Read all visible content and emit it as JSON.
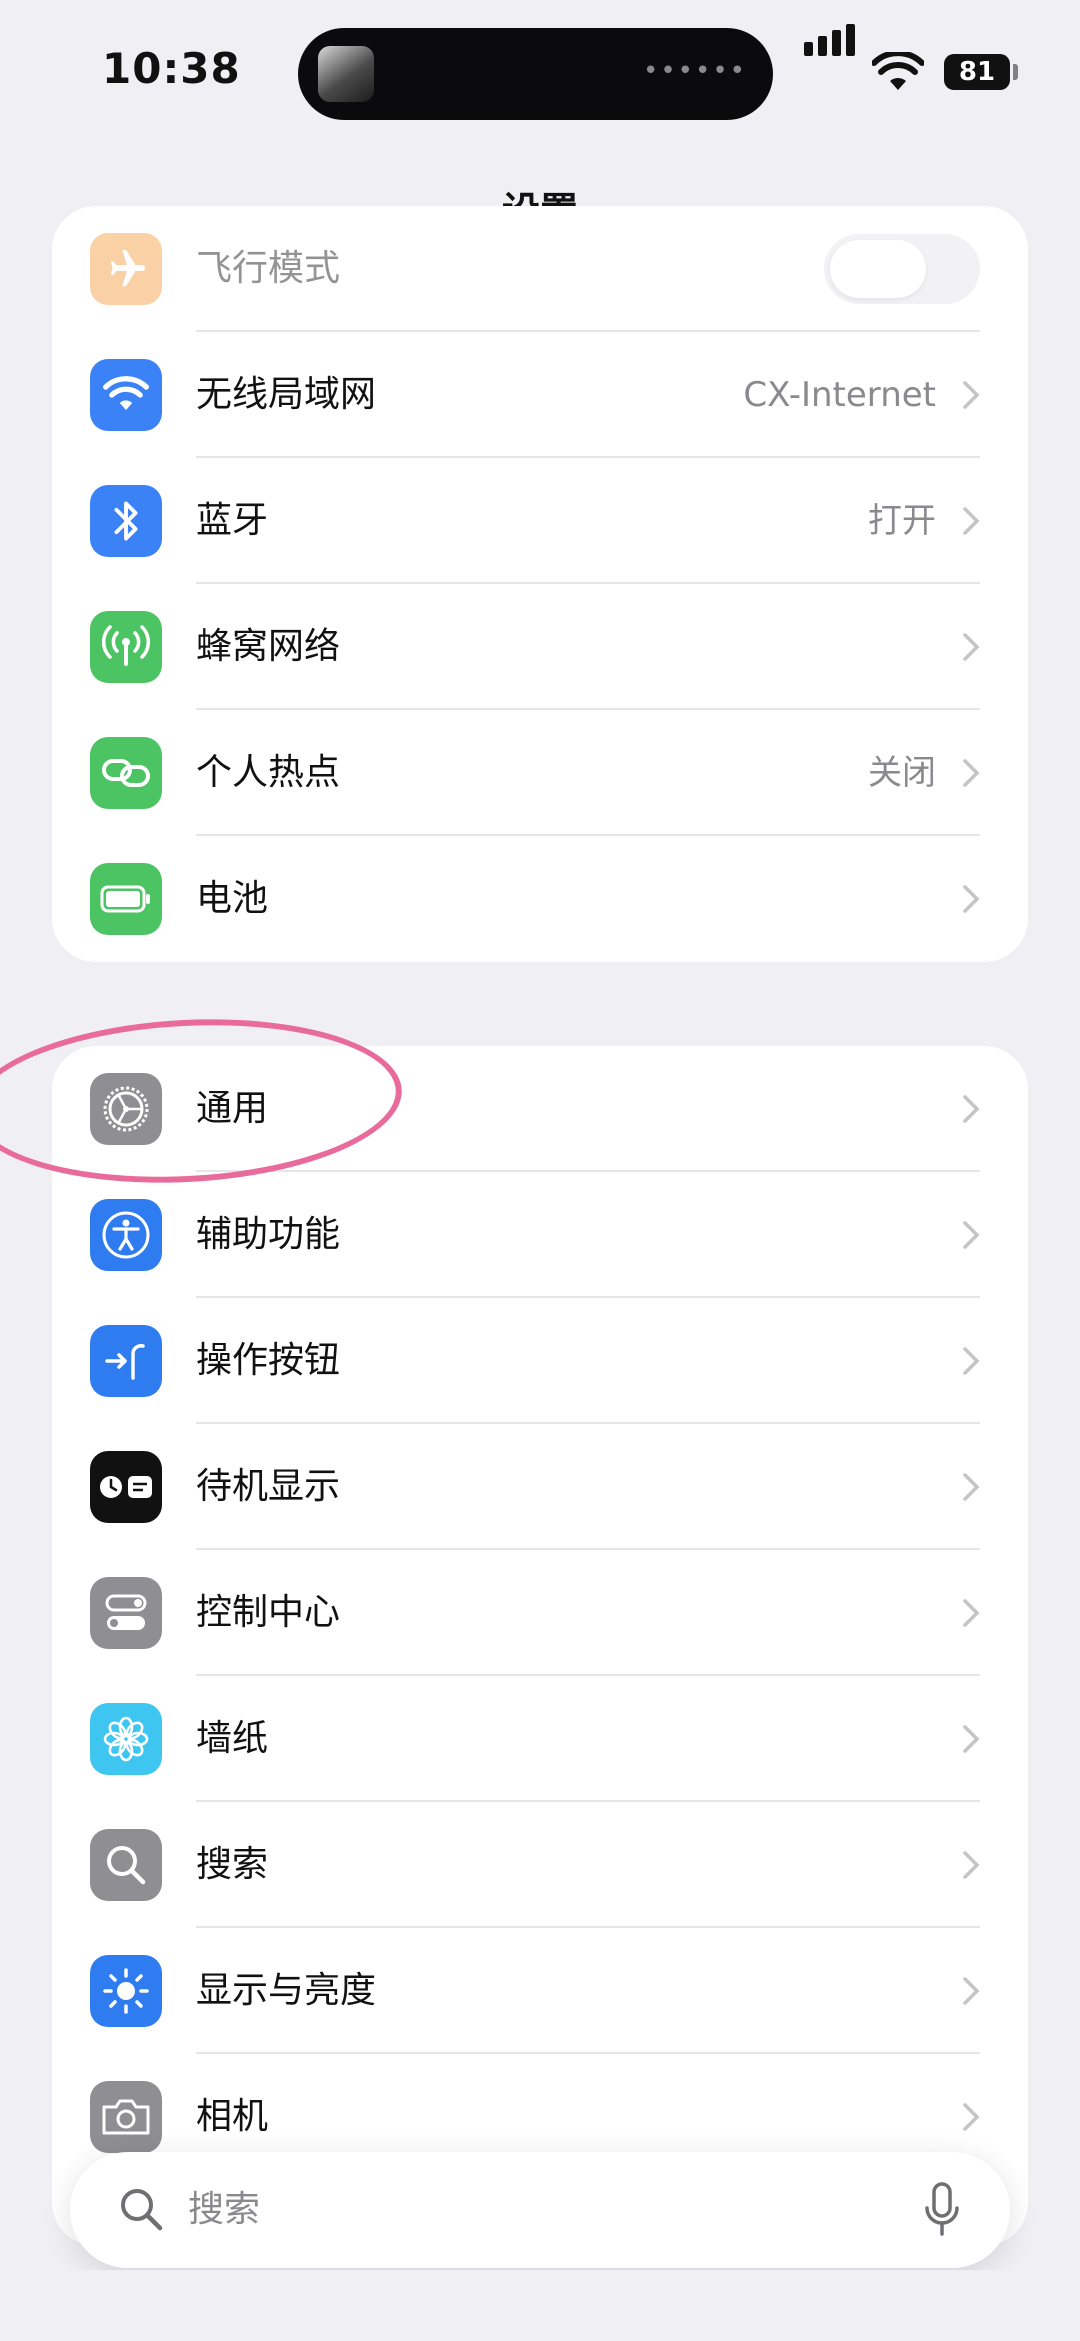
{
  "status_bar": {
    "time": "10:38",
    "battery": "81"
  },
  "nav": {
    "title": "设置"
  },
  "group1": [
    {
      "label": "飞行模式",
      "value": "",
      "icon": "airplane-icon",
      "color": "#f59a3b",
      "toggle": true
    },
    {
      "label": "无线局域网",
      "value": "CX-Internet",
      "icon": "wifi-icon",
      "color": "#3b82f6"
    },
    {
      "label": "蓝牙",
      "value": "打开",
      "icon": "bluetooth-icon",
      "color": "#3b82f6"
    },
    {
      "label": "蜂窝网络",
      "value": "",
      "icon": "cellular-icon",
      "color": "#4cc463"
    },
    {
      "label": "个人热点",
      "value": "关闭",
      "icon": "hotspot-icon",
      "color": "#4cc463"
    },
    {
      "label": "电池",
      "value": "",
      "icon": "battery-icon",
      "color": "#4cc463"
    }
  ],
  "group2": [
    {
      "label": "通用",
      "icon": "gear-icon",
      "color": "#8e8e93"
    },
    {
      "label": "辅助功能",
      "icon": "accessibility-icon",
      "color": "#2f7bf0"
    },
    {
      "label": "操作按钮",
      "icon": "action-button-icon",
      "color": "#2f7bf0"
    },
    {
      "label": "待机显示",
      "icon": "standby-icon",
      "color": "#111111"
    },
    {
      "label": "控制中心",
      "icon": "control-center-icon",
      "color": "#8e8e93"
    },
    {
      "label": "墙纸",
      "icon": "wallpaper-icon",
      "color": "#3ec5f0"
    },
    {
      "label": "搜索",
      "icon": "search-icon",
      "color": "#8e8e93"
    },
    {
      "label": "显示与亮度",
      "icon": "brightness-icon",
      "color": "#2f7bf0"
    },
    {
      "label": "相机",
      "icon": "camera-icon",
      "color": "#8e8e93"
    }
  ],
  "search": {
    "placeholder": "搜索"
  }
}
